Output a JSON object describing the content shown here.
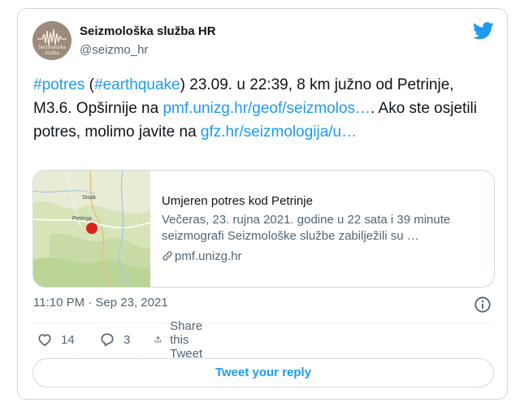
{
  "author": {
    "name": "Seizmološka služba HR",
    "handle": "@seizmo_hr",
    "avatar_text_line1": "Seizmološka",
    "avatar_text_line2": "služba"
  },
  "tweet": {
    "segments": [
      {
        "text": "#potres",
        "type": "link"
      },
      {
        "text": " (",
        "type": "text"
      },
      {
        "text": "#earthquake",
        "type": "link"
      },
      {
        "text": ") 23.09. u 22:39, 8 km južno od Petrinje, M3.6. Opširnije na ",
        "type": "text"
      },
      {
        "text": "pmf.unizg.hr/geof/seizmolos…",
        "type": "link"
      },
      {
        "text": ". Ako ste osjetili potres, molimo javite na ",
        "type": "text"
      },
      {
        "text": "gfz.hr/seizmologija/u…",
        "type": "link"
      }
    ]
  },
  "card": {
    "title": "Umjeren potres kod Petrinje",
    "description": "Večeras, 23. rujna 2021. godine u 22 sata i 39 minute seizmografi Seizmološke službe zabilježili su …",
    "domain": "pmf.unizg.hr",
    "map_labels": [
      "Sisak",
      "Petrinja"
    ]
  },
  "meta": {
    "timestamp": "11:10 PM · Sep 23, 2021"
  },
  "actions": {
    "likes": "14",
    "replies": "3",
    "share_label": "Share this Tweet"
  },
  "reply_button": "Tweet your reply",
  "colors": {
    "link": "#1d9bf0",
    "secondary_text": "#536471",
    "border": "#cfd9de",
    "epicenter": "#e0201c"
  },
  "icons": [
    "twitter-bird-icon",
    "info-icon",
    "heart-icon",
    "reply-icon",
    "share-icon",
    "link-icon"
  ]
}
